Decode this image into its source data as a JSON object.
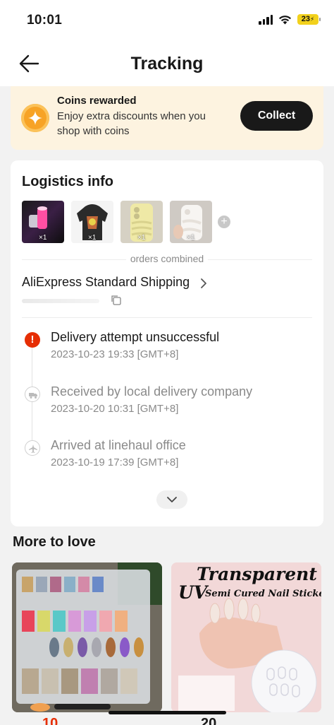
{
  "status_bar": {
    "time": "10:01",
    "battery": "23"
  },
  "nav": {
    "title": "Tracking",
    "back_icon": "arrow-left-icon"
  },
  "coins": {
    "title": "Coins rewarded",
    "description": "Enjoy extra discounts when you shop with coins",
    "button": "Collect",
    "icon": "star-coin-icon"
  },
  "logistics": {
    "title": "Logistics info",
    "items": [
      {
        "qty": "×1",
        "icon": "nail-stamper-product"
      },
      {
        "qty": "×1",
        "icon": "hoodie-product"
      },
      {
        "qty": "×1",
        "icon": "phone-case-yellow-product"
      },
      {
        "qty": "×1",
        "icon": "phone-case-white-product"
      }
    ],
    "orders_combined": "orders combined",
    "shipping_method": "AliExpress Standard Shipping",
    "events": [
      {
        "status": "Delivery attempt unsuccessful",
        "time": "2023-10-23 19:33 [GMT+8]"
      },
      {
        "status": "Received by local delivery company",
        "time": "2023-10-20 10:31 [GMT+8]"
      },
      {
        "status": "Arrived at linehaul office",
        "time": "2023-10-19 17:39 [GMT+8]"
      }
    ]
  },
  "more_to_love": {
    "title": "More to love",
    "products": [
      {
        "icon": "chrome-nail-tips-product",
        "price_peek": "10"
      },
      {
        "banner_title": "Transparent",
        "banner_uv": "UV",
        "banner_sub": "Semi Cured Nail Stickers",
        "price_peek": "20"
      }
    ]
  },
  "colors": {
    "accent": "#e62e04",
    "coin": "#f7a326",
    "banner_bg": "#fdf3e0",
    "button_dark": "#191919"
  }
}
